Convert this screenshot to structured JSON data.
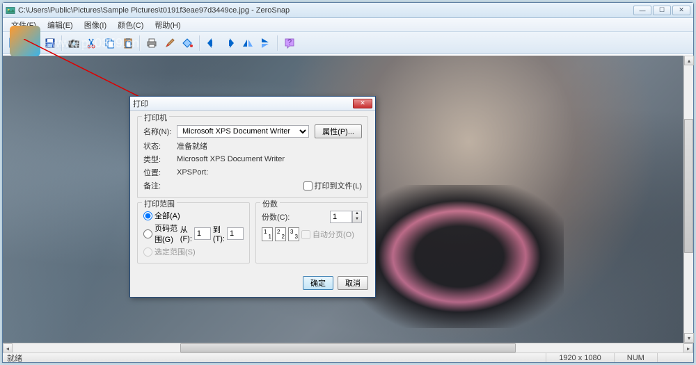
{
  "window": {
    "title": "C:\\Users\\Public\\Pictures\\Sample Pictures\\t0191f3eae97d3449ce.jpg - ZeroSnap",
    "min": "—",
    "max": "☐",
    "close": "✕"
  },
  "menu": {
    "file": "文件(F)",
    "edit": "编辑(E)",
    "image": "图像(I)",
    "color": "颜色(C)",
    "help": "帮助(H)"
  },
  "watermark": {
    "text": "河东软件园",
    "url": "www.pc0359.cn"
  },
  "status": {
    "ready": "就绪",
    "dim": "1920 x 1080",
    "num": "NUM"
  },
  "dialog": {
    "title": "打印",
    "printer_group": "打印机",
    "name_label": "名称(N):",
    "name_value": "Microsoft XPS Document Writer",
    "props_btn": "属性(P)...",
    "status_label": "状态:",
    "status_value": "准备就绪",
    "type_label": "类型:",
    "type_value": "Microsoft XPS Document Writer",
    "where_label": "位置:",
    "where_value": "XPSPort:",
    "comment_label": "备注:",
    "comment_value": "",
    "print_to_file": "打印到文件(L)",
    "range_group": "打印范围",
    "range_all": "全部(A)",
    "range_pages": "页码范围(G)",
    "from_label": "从(F):",
    "from_value": "1",
    "to_label": "到(T):",
    "to_value": "1",
    "range_selection": "选定范围(S)",
    "copies_group": "份数",
    "copies_label": "份数(C):",
    "copies_value": "1",
    "collate_label": "自动分页(O)",
    "ok": "确定",
    "cancel": "取消"
  }
}
